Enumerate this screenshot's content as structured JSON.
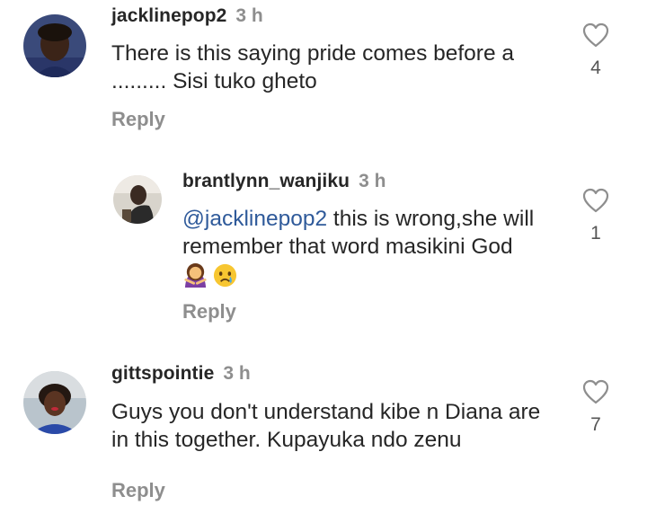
{
  "comments": [
    {
      "username": "jacklinepop2",
      "time": "3 h",
      "text": "There is this saying pride comes before a ......... Sisi tuko gheto",
      "reply_label": "Reply",
      "likes": "4"
    },
    {
      "username": "brantlynn_wanjiku",
      "time": "3 h",
      "mention": "@jacklinepop2",
      "text": " this is wrong,she will remember that word masikini God",
      "emojis": [
        "woman-gesturing-no-emoji",
        "crying-face-emoji"
      ],
      "reply_label": "Reply",
      "likes": "1"
    },
    {
      "username": "gittspointie",
      "time": "3 h",
      "text": "Guys you don't understand kibe n Diana are in this together. Kupayuka ndo zenu",
      "reply_label": "Reply",
      "likes": "7"
    }
  ],
  "icons": {
    "like": "heart-outline-icon"
  },
  "colors": {
    "username": "#262626",
    "secondary": "#8e8e8e",
    "mention": "#2f5a9a"
  }
}
